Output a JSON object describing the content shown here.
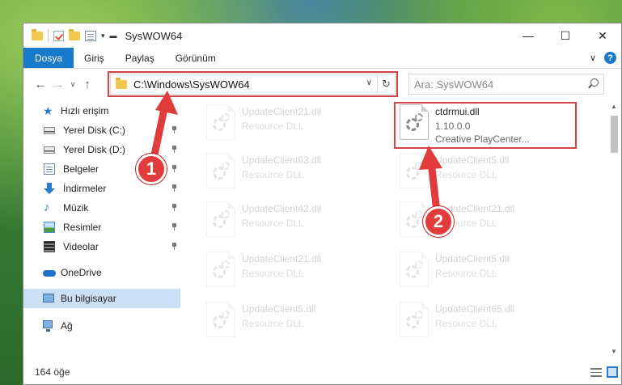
{
  "window": {
    "title": "SysWOW64"
  },
  "window_controls": {
    "minimize": "—",
    "maximize": "☐",
    "close": "✕"
  },
  "ribbon": {
    "tabs": [
      "Dosya",
      "Giriş",
      "Paylaş",
      "Görünüm"
    ]
  },
  "nav": {
    "back": "←",
    "forward": "→",
    "recent": "∨",
    "up": "↑",
    "address": "C:\\Windows\\SysWOW64",
    "search_placeholder": "Ara: SysWOW64"
  },
  "sidebar": {
    "items": [
      {
        "label": "Hızlı erişim",
        "icon": "star-icon",
        "pinned": false
      },
      {
        "label": "Yerel Disk (C:)",
        "icon": "disk-icon",
        "pinned": true
      },
      {
        "label": "Yerel Disk (D:)",
        "icon": "disk-icon",
        "pinned": true
      },
      {
        "label": "Belgeler",
        "icon": "document-icon",
        "pinned": true
      },
      {
        "label": "İndirmeler",
        "icon": "download-icon",
        "pinned": true
      },
      {
        "label": "Müzik",
        "icon": "music-icon",
        "pinned": true
      },
      {
        "label": "Resimler",
        "icon": "pictures-icon",
        "pinned": true
      },
      {
        "label": "Videolar",
        "icon": "videos-icon",
        "pinned": true
      },
      {
        "label": "OneDrive",
        "icon": "onedrive-icon",
        "pinned": false
      },
      {
        "label": "Bu bilgisayar",
        "icon": "computer-icon",
        "pinned": false,
        "selected": true
      },
      {
        "label": "Ağ",
        "icon": "network-icon",
        "pinned": false
      }
    ]
  },
  "files": {
    "selected": {
      "name": "ctdrmui.dll",
      "version": "1.10.0.0",
      "company": "Creative PlayCenter..."
    },
    "ghost_left": [
      {
        "name": "UpdateClient21.dll",
        "type": "Resource DLL"
      },
      {
        "name": "UpdateClient63.dll",
        "type": "Resource DLL"
      },
      {
        "name": "UpdateClient42.dll",
        "type": "Resource DLL"
      },
      {
        "name": "UpdateClient21.dll",
        "type": "Resource DLL"
      },
      {
        "name": "UpdateClient5.dll",
        "type": "Resource DLL"
      }
    ],
    "ghost_right": [
      {
        "name": "UpdateClient5.dll",
        "type": "Resource DLL"
      },
      {
        "name": "UpdateClient21.dll",
        "type": "Resource DLL"
      },
      {
        "name": "UpdateClient5.dll",
        "type": "Resource DLL"
      },
      {
        "name": "UpdateClient65.dll",
        "type": "Resource DLL"
      }
    ]
  },
  "status": {
    "count": "164 öğe"
  },
  "annotations": {
    "step1": "1",
    "step2": "2"
  },
  "colors": {
    "accent": "#1979ca",
    "highlight": "#d64545",
    "badge": "#e23b3b"
  }
}
